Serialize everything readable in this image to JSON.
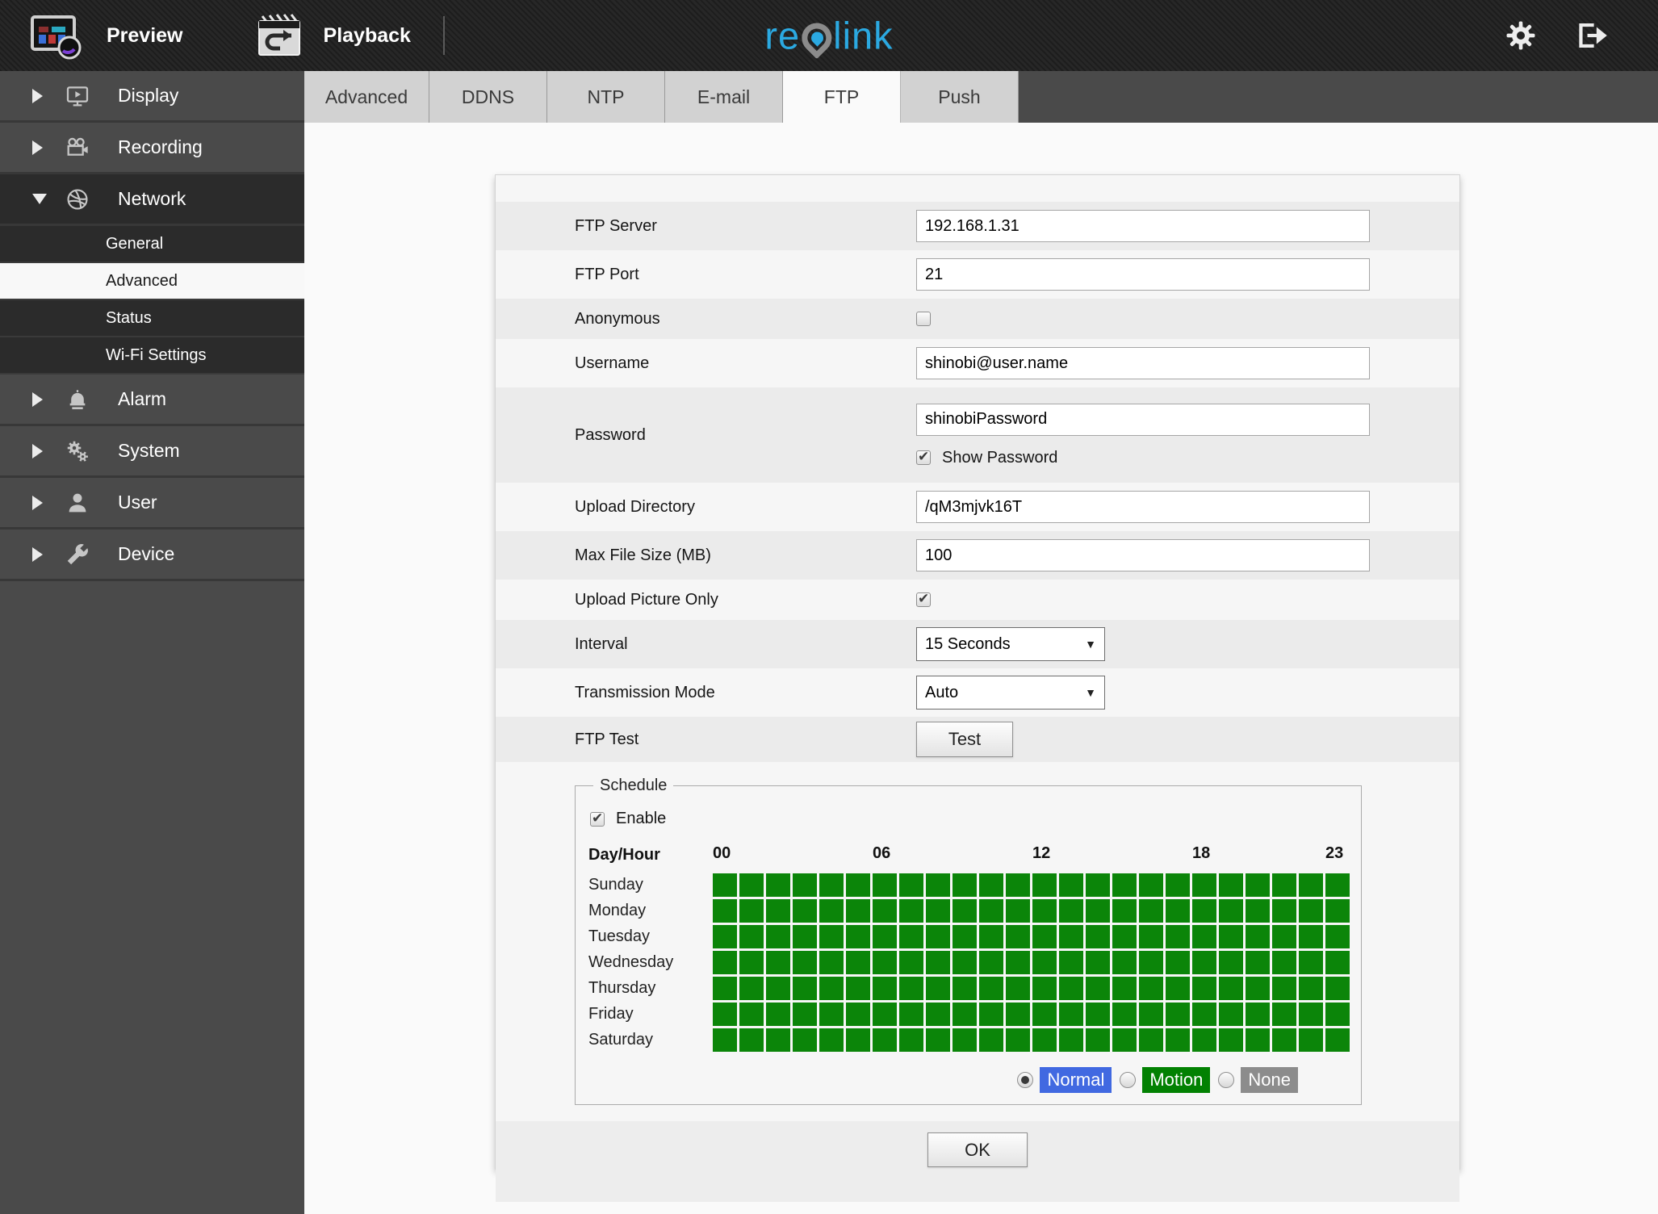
{
  "topbar": {
    "preview_label": "Preview",
    "playback_label": "Playback",
    "logo": {
      "prefix": "re",
      "suffix": "link"
    }
  },
  "sidebar": {
    "items": [
      {
        "label": "Display",
        "type": "main",
        "expanded": false
      },
      {
        "label": "Recording",
        "type": "main",
        "expanded": false
      },
      {
        "label": "Network",
        "type": "main",
        "expanded": true
      },
      {
        "label": "General",
        "type": "sub",
        "active": false
      },
      {
        "label": "Advanced",
        "type": "sub",
        "active": true
      },
      {
        "label": "Status",
        "type": "sub",
        "active": false
      },
      {
        "label": "Wi-Fi Settings",
        "type": "sub",
        "active": false
      },
      {
        "label": "Alarm",
        "type": "main",
        "expanded": false
      },
      {
        "label": "System",
        "type": "main",
        "expanded": false
      },
      {
        "label": "User",
        "type": "main",
        "expanded": false
      },
      {
        "label": "Device",
        "type": "main",
        "expanded": false
      }
    ]
  },
  "tabs": {
    "active": "FTP",
    "items": [
      {
        "label": "Advanced",
        "active": false
      },
      {
        "label": "DDNS",
        "active": false
      },
      {
        "label": "NTP",
        "active": false
      },
      {
        "label": "E-mail",
        "active": false
      },
      {
        "label": "FTP",
        "active": true
      },
      {
        "label": "Push",
        "active": false
      }
    ]
  },
  "form": {
    "ftp_server": {
      "label": "FTP Server",
      "value": "192.168.1.31"
    },
    "ftp_port": {
      "label": "FTP Port",
      "value": "21"
    },
    "anonymous": {
      "label": "Anonymous",
      "checked": false
    },
    "username": {
      "label": "Username",
      "value": "shinobi@user.name"
    },
    "password": {
      "label": "Password",
      "value": "shinobiPassword",
      "show_password_label": "Show Password",
      "show_password_checked": true
    },
    "upload_directory": {
      "label": "Upload Directory",
      "value": "/qM3mjvk16T"
    },
    "max_file_size": {
      "label": "Max File Size (MB)",
      "value": "100"
    },
    "upload_picture_only": {
      "label": "Upload Picture Only",
      "checked": true
    },
    "interval": {
      "label": "Interval",
      "value": "15 Seconds"
    },
    "transmission_mode": {
      "label": "Transmission Mode",
      "value": "Auto"
    },
    "ftp_test": {
      "label": "FTP Test",
      "button_label": "Test"
    }
  },
  "schedule": {
    "legend": "Schedule",
    "enable_label": "Enable",
    "enable_checked": true,
    "corner_label": "Day/Hour",
    "hour_labels": [
      {
        "text": "00",
        "col": 0
      },
      {
        "text": "06",
        "col": 6
      },
      {
        "text": "12",
        "col": 12
      },
      {
        "text": "18",
        "col": 18
      },
      {
        "text": "23",
        "col": 23
      }
    ],
    "cell_on_color": "#0b8509",
    "rows": [
      {
        "day": "Sunday",
        "cells": "111111111111111111111111"
      },
      {
        "day": "Monday",
        "cells": "111111111111111111111111"
      },
      {
        "day": "Tuesday",
        "cells": "111111111111111111111111"
      },
      {
        "day": "Wednesday",
        "cells": "111111111111111111111111"
      },
      {
        "day": "Thursday",
        "cells": "111111111111111111111111"
      },
      {
        "day": "Friday",
        "cells": "111111111111111111111111"
      },
      {
        "day": "Saturday",
        "cells": "111111111111111111111111"
      }
    ],
    "modes": [
      {
        "label": "Normal",
        "color": "#4169e1",
        "selected": true
      },
      {
        "label": "Motion",
        "color": "#028102",
        "selected": false
      },
      {
        "label": "None",
        "color": "#8c8c8c",
        "selected": false
      }
    ]
  },
  "footer": {
    "ok_label": "OK"
  }
}
